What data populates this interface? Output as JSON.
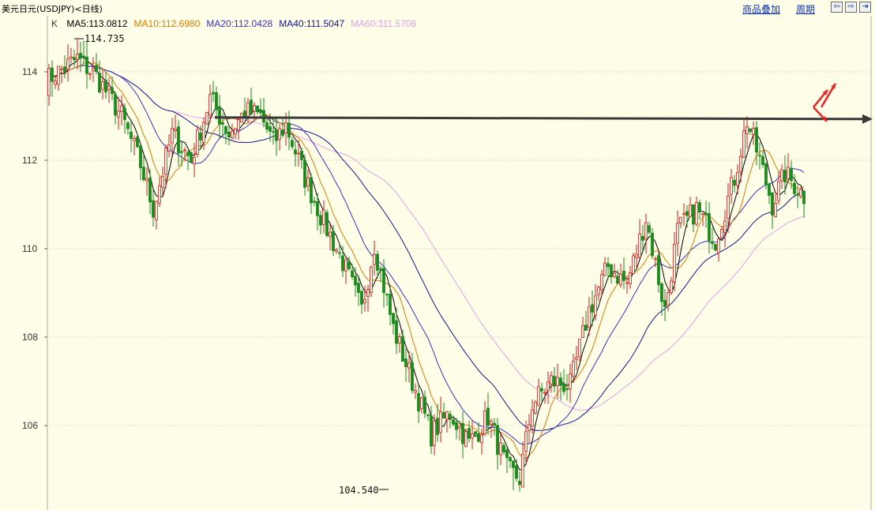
{
  "header": {
    "title": "美元日元(USDJPY)<日线)",
    "overlay_label": "商品叠加",
    "period_label": "周期",
    "nav_buttons": [
      {
        "name": "nav-back-button",
        "glyph": "⇦"
      },
      {
        "name": "nav-forward-button",
        "glyph": "⇨"
      },
      {
        "name": "nav-end-button",
        "glyph": "⇥"
      }
    ]
  },
  "indicators": {
    "k_label": "K",
    "items": [
      {
        "text": "MA5:113.0812",
        "color": "#000000"
      },
      {
        "text": "MA10:112.6980",
        "color": "#e07c00"
      },
      {
        "text": "MA20:112.0428",
        "color": "#3a32c6"
      },
      {
        "text": "MA40:111.5047",
        "color": "#141490"
      },
      {
        "text": "MA60:111.5706",
        "color": "#e8a0e8"
      }
    ]
  },
  "annotations": {
    "high_label": "114.735",
    "low_label": "104.540"
  },
  "chart_data": {
    "type": "candlestick",
    "ylim": [
      104.3,
      115.25
    ],
    "yticks": [
      106,
      108,
      110,
      112,
      114
    ],
    "ytick_labels": [
      "106",
      "108",
      "110",
      "112",
      "114"
    ],
    "grid": true,
    "colors": {
      "up": "#e01818",
      "down": "#1c8a1c",
      "ma5": "#000000",
      "ma10": "#e07c00",
      "ma20": "#3a32c6",
      "ma40": "#141490",
      "ma60": "#e8a0e8",
      "resistance": "#3a3a3a",
      "arrows": "#ee2222"
    },
    "high": 114.735,
    "low": 104.54,
    "resistance_level": 112.95,
    "n_bars": 240,
    "anchors": [
      [
        0,
        113.8
      ],
      [
        10,
        114.3
      ],
      [
        16,
        113.9
      ],
      [
        24,
        113.0
      ],
      [
        30,
        111.9
      ],
      [
        34,
        110.9
      ],
      [
        40,
        112.6
      ],
      [
        46,
        112.0
      ],
      [
        52,
        113.4
      ],
      [
        58,
        112.6
      ],
      [
        63,
        113.1
      ],
      [
        68,
        113.0
      ],
      [
        72,
        112.4
      ],
      [
        76,
        112.8
      ],
      [
        82,
        111.6
      ],
      [
        88,
        110.6
      ],
      [
        94,
        109.7
      ],
      [
        100,
        108.6
      ],
      [
        104,
        110.1
      ],
      [
        110,
        108.2
      ],
      [
        116,
        107.0
      ],
      [
        122,
        105.8
      ],
      [
        128,
        106.3
      ],
      [
        134,
        105.6
      ],
      [
        140,
        106.2
      ],
      [
        146,
        105.0
      ],
      [
        150,
        104.8
      ],
      [
        154,
        106.5
      ],
      [
        160,
        107.0
      ],
      [
        166,
        106.9
      ],
      [
        172,
        108.6
      ],
      [
        178,
        109.6
      ],
      [
        184,
        109.2
      ],
      [
        190,
        110.7
      ],
      [
        196,
        108.6
      ],
      [
        200,
        110.4
      ],
      [
        206,
        110.9
      ],
      [
        212,
        110.2
      ],
      [
        218,
        111.6
      ],
      [
        222,
        112.9
      ],
      [
        226,
        112.0
      ],
      [
        230,
        111.0
      ],
      [
        234,
        111.7
      ],
      [
        240,
        111.2
      ]
    ]
  }
}
